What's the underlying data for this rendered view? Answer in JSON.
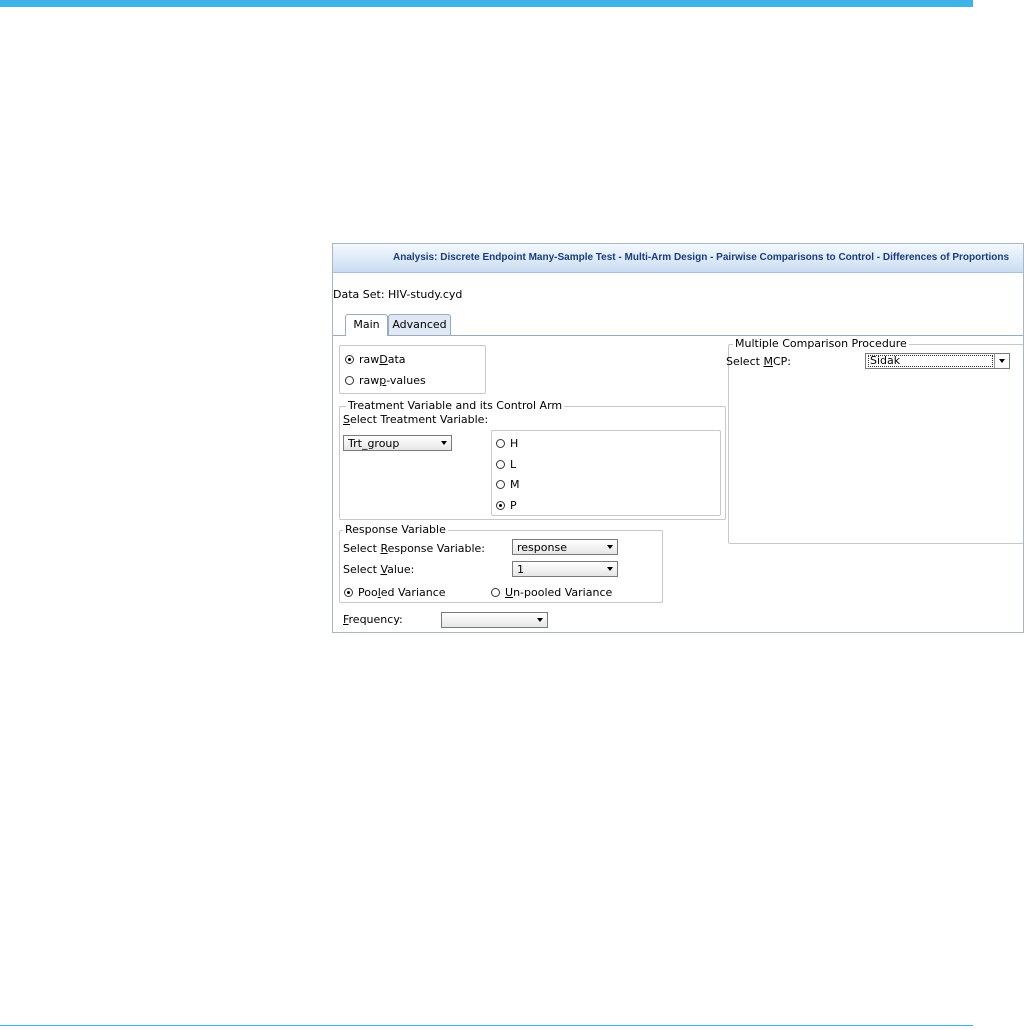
{
  "window": {
    "title": "Analysis: Discrete Endpoint Many-Sample Test - Multi-Arm Design - Pairwise Comparisons to Control - Differences of Proportions"
  },
  "dataset": {
    "label": "Data Set: HIV-study.cyd"
  },
  "tabs": [
    {
      "label": "Main",
      "active": true
    },
    {
      "label": "Advanced",
      "active": false
    }
  ],
  "input_type": {
    "options": [
      {
        "pre": "raw ",
        "u": "D",
        "post": "ata",
        "selected": true
      },
      {
        "pre": "raw ",
        "u": "p",
        "post": "-values",
        "selected": false
      }
    ]
  },
  "treatment": {
    "legend": "Treatment Variable and its Control Arm",
    "select_label_u": "S",
    "select_label_rest": "elect Treatment Variable:",
    "variable": "Trt_group",
    "arms": [
      {
        "label": "H",
        "selected": false
      },
      {
        "label": "L",
        "selected": false
      },
      {
        "label": "M",
        "selected": false
      },
      {
        "label": "P",
        "selected": true
      }
    ]
  },
  "response": {
    "legend": "Response Variable",
    "var_pre": "Select ",
    "var_u": "R",
    "var_post": "esponse Variable:",
    "variable": "response",
    "value_pre": "Select ",
    "value_u": "V",
    "value_post": "alue:",
    "value": "1",
    "variance": [
      {
        "pre": "Poo",
        "u": "l",
        "post": "ed Variance",
        "selected": true
      },
      {
        "pre": "",
        "u": "U",
        "post": "n-pooled Variance",
        "selected": false
      }
    ]
  },
  "frequency": {
    "u": "F",
    "rest": "requency:",
    "value": ""
  },
  "mcp": {
    "legend": "Multiple Comparison Procedure",
    "label_pre": "Select ",
    "label_u": "M",
    "label_post": "CP:",
    "value": "Sidak"
  },
  "colors": {
    "accent": "#3db3e6",
    "title_text": "#1c3d7a"
  }
}
